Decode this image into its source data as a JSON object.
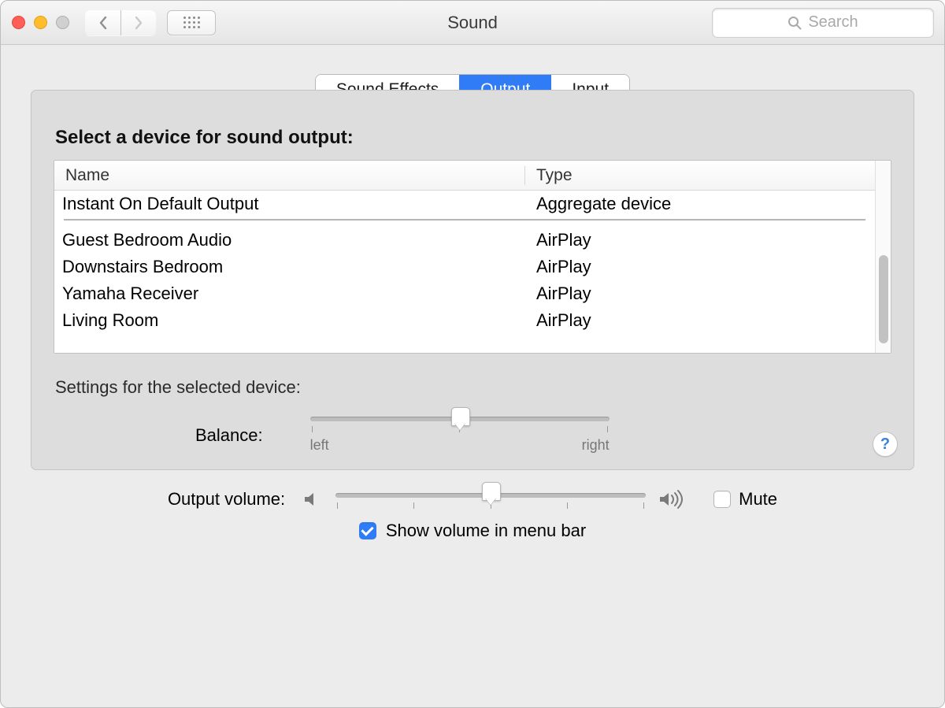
{
  "window": {
    "title": "Sound"
  },
  "search": {
    "placeholder": "Search"
  },
  "tabs": [
    {
      "label": "Sound Effects",
      "active": false
    },
    {
      "label": "Output",
      "active": true
    },
    {
      "label": "Input",
      "active": false
    }
  ],
  "panel": {
    "heading": "Select a device for sound output:",
    "columns": {
      "name": "Name",
      "type": "Type"
    },
    "devices_group1": [
      {
        "name": "Instant On Default Output",
        "type": "Aggregate device"
      }
    ],
    "devices_group2": [
      {
        "name": "Guest Bedroom Audio",
        "type": "AirPlay"
      },
      {
        "name": "Downstairs Bedroom",
        "type": "AirPlay"
      },
      {
        "name": "Yamaha Receiver",
        "type": "AirPlay"
      },
      {
        "name": "Living Room",
        "type": "AirPlay"
      }
    ],
    "settings_label": "Settings for the selected device:",
    "balance": {
      "label": "Balance:",
      "left": "left",
      "right": "right",
      "value": 0.5
    },
    "help_label": "?"
  },
  "footer": {
    "output_volume_label": "Output volume:",
    "output_volume_value": 0.5,
    "mute_label": "Mute",
    "mute_checked": false,
    "show_in_menu_bar_label": "Show volume in menu bar",
    "show_in_menu_bar_checked": true
  }
}
